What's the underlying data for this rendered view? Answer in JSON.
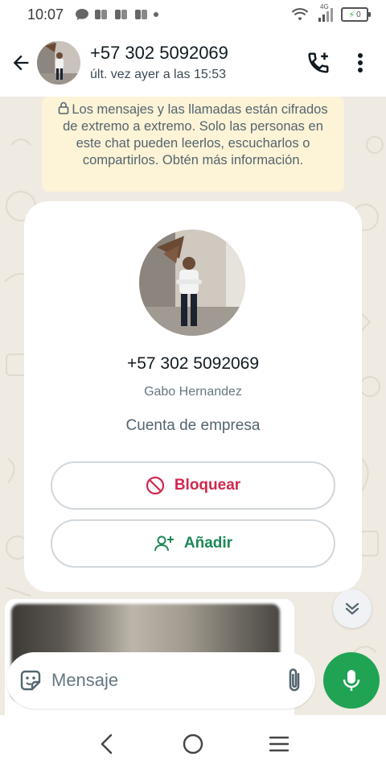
{
  "status_bar": {
    "time": "10:07",
    "network": "4G",
    "battery": "0"
  },
  "header": {
    "title": "+57 302 5092069",
    "last_seen": "últ. vez ayer a las 15:53"
  },
  "encryption_notice": "Los mensajes y las llamadas están cifrados de extremo a extremo. Solo las personas en este chat pueden leerlos, escucharlos o compartirlos. Obtén más información.",
  "profile_card": {
    "phone": "+57 302 5092069",
    "name": "Gabo Hernandez",
    "account_type": "Cuenta de empresa",
    "block_label": "Bloquear",
    "add_label": "Añadir"
  },
  "composer": {
    "placeholder": "Mensaje"
  },
  "colors": {
    "accent": "#21a354",
    "danger": "#d1284e",
    "notice_bg": "#fdf3d7",
    "chat_bg": "#efeae2"
  },
  "icons": [
    "back-arrow-icon",
    "add-call-icon",
    "more-vert-icon",
    "lock-icon",
    "block-icon",
    "add-contact-icon",
    "chevron-double-down-icon",
    "sticker-icon",
    "attach-icon",
    "camera-icon",
    "mic-icon",
    "nav-back-icon",
    "nav-home-icon",
    "nav-menu-icon"
  ]
}
